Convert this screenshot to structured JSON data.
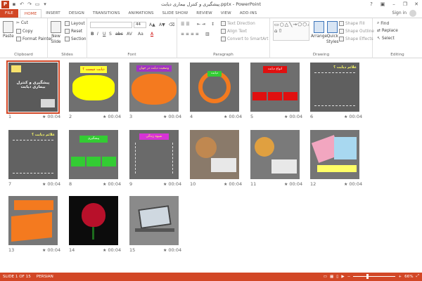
{
  "titlebar": {
    "title": "پیشگیری و کنترل بیماری دیابت.pptx - PowerPoint",
    "logo": "P",
    "minimize": "–",
    "restore": "❐",
    "close": "✕",
    "help": "?"
  },
  "tabs": [
    "FILE",
    "HOME",
    "INSERT",
    "DESIGN",
    "TRANSITIONS",
    "ANIMATIONS",
    "SLIDE SHOW",
    "REVIEW",
    "VIEW",
    "ADD-INS"
  ],
  "signin": "Sign in",
  "ribbon": {
    "clipboard": {
      "label": "Clipboard",
      "paste": "Paste",
      "cut": "Cut",
      "copy": "Copy",
      "format_painter": "Format Painter"
    },
    "slides": {
      "label": "Slides",
      "new_slide": "New",
      "new_slide2": "Slide",
      "layout": "Layout",
      "reset": "Reset",
      "section": "Section"
    },
    "font": {
      "label": "Font",
      "size": "44",
      "bold": "B",
      "italic": "I",
      "underline": "U",
      "strike": "S",
      "abc": "abc",
      "av": "AV",
      "aa": "Aa",
      "a": "A"
    },
    "paragraph": {
      "label": "Paragraph",
      "text_direction": "Text Direction",
      "align_text": "Align Text",
      "convert": "Convert to SmartArt"
    },
    "drawing": {
      "label": "Drawing",
      "arrange": "Arrange",
      "quick_styles": "Quick",
      "quick_styles2": "Styles",
      "shape_fill": "Shape Fill",
      "shape_outline": "Shape Outline",
      "shape_effects": "Shape Effects"
    },
    "editing": {
      "label": "Editing",
      "find": "Find",
      "replace": "Replace",
      "select": "Select"
    }
  },
  "slides": [
    {
      "num": "1",
      "time": "00:04",
      "title": "پیشگیری و کنترل بیماری دیابت"
    },
    {
      "num": "2",
      "time": "00:04",
      "title": "دیابت چیست ؟"
    },
    {
      "num": "3",
      "time": "00:04",
      "title": "وضعیت دیابت در جهان"
    },
    {
      "num": "4",
      "time": "00:04",
      "title": "دیابت"
    },
    {
      "num": "5",
      "time": "00:04",
      "title": "انواع دیابت"
    },
    {
      "num": "6",
      "time": "00:04",
      "title": "علائم دیابت ؟"
    },
    {
      "num": "7",
      "time": "00:04",
      "title": "علائم دیابت ؟"
    },
    {
      "num": "8",
      "time": "00:04",
      "title": "پیشگیری"
    },
    {
      "num": "9",
      "time": "00:04",
      "title": "شیوه زندگی"
    },
    {
      "num": "10",
      "time": "00:04",
      "title": ""
    },
    {
      "num": "11",
      "time": "00:04",
      "title": ""
    },
    {
      "num": "12",
      "time": "00:04",
      "title": ""
    },
    {
      "num": "13",
      "time": "00:04",
      "title": ""
    },
    {
      "num": "14",
      "time": "00:04",
      "title": ""
    },
    {
      "num": "15",
      "time": "00:04",
      "title": ""
    }
  ],
  "status": {
    "slide_of": "SLIDE 1 OF 15",
    "language": "PERSIAN",
    "zoom": "66%",
    "zoom_fraction": 0.66
  }
}
